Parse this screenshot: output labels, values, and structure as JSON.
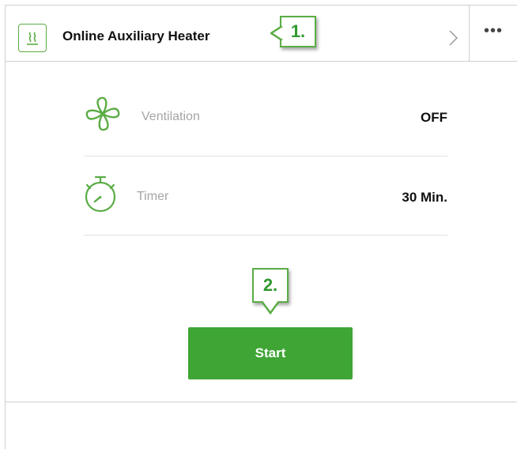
{
  "header": {
    "title": "Online Auxiliary Heater",
    "icon": "heater-icon",
    "more_label": "•••"
  },
  "callouts": {
    "first": "1.",
    "second": "2."
  },
  "settings": [
    {
      "label": "Ventilation",
      "value": "OFF",
      "icon": "fan-icon"
    },
    {
      "label": "Timer",
      "value": "30 Min.",
      "icon": "stopwatch-icon"
    }
  ],
  "actions": {
    "start_label": "Start"
  },
  "colors": {
    "accent": "#3fa535",
    "icon_green": "#5aac45",
    "label_gray": "#a5a5a5"
  }
}
